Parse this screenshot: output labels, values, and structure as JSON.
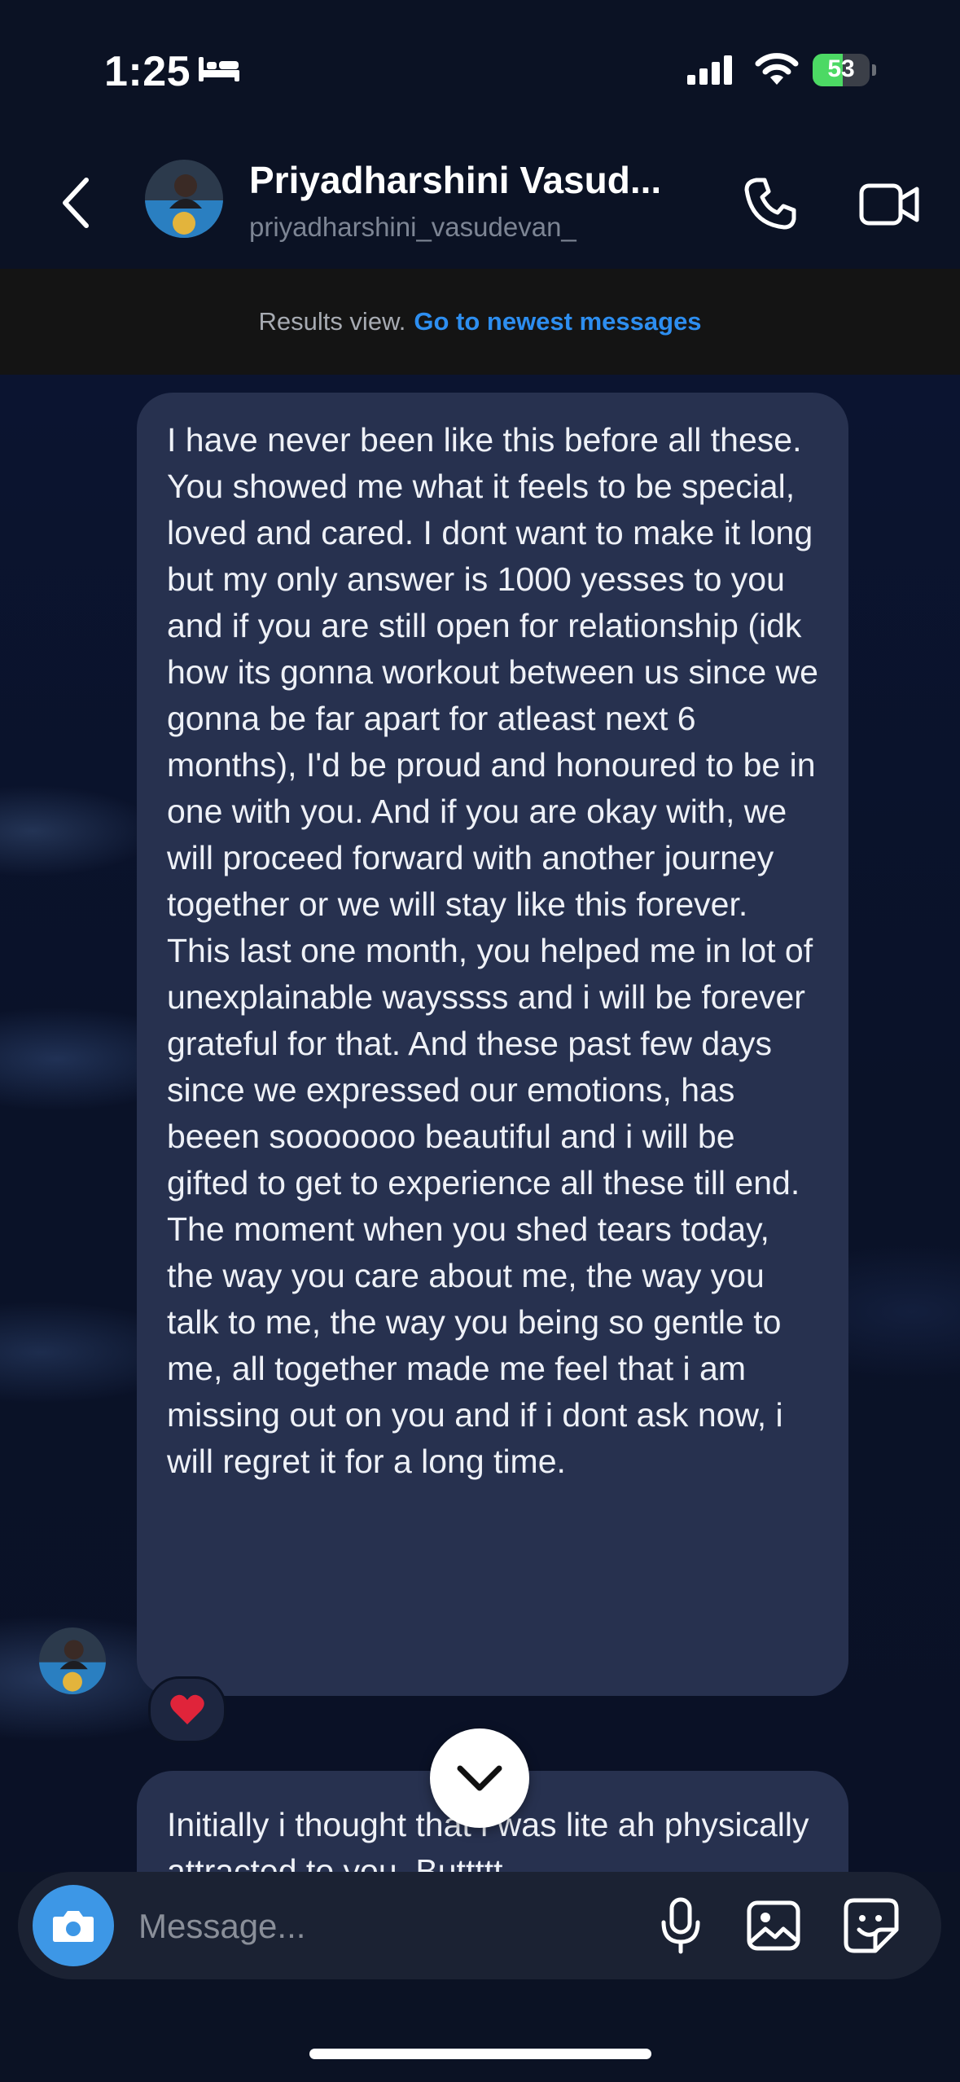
{
  "status_bar": {
    "time": "1:25",
    "battery_percent": "53",
    "battery_level": 0.53,
    "icons": [
      "bed-icon",
      "signal-icon",
      "wifi-icon",
      "battery-icon"
    ]
  },
  "header": {
    "contact_name": "Priyadharshini Vasud...",
    "username": "priyadharshini_vasudevan_",
    "icons": [
      "back-chevron-icon",
      "phone-icon",
      "video-camera-icon"
    ]
  },
  "banner": {
    "text": "Results view.",
    "link": "Go to newest messages"
  },
  "messages": [
    {
      "text": "I have never been like this before all these. You showed me what it feels to be special, loved and cared. I dont want to make it long but my only answer is 1000 yesses to you and if you are still open for relationship (idk how its gonna workout between us since we gonna be far apart for atleast next 6 months), I'd be proud and honoured to be in one with you. And if you are okay with, we will proceed forward with another journey together or we will stay like this forever. This last one month, you helped me in lot of unexplainable wayssss and i will be forever grateful for that. And these past few days since we expressed our emotions, has beeen sooooooo beautiful and i will be gifted to get to experience all these till end. The moment when you shed tears today, the way you care about me, the way you talk to me, the way you being so gentle to me, all together made me feel that i am missing out on you and if i dont ask now, i will regret it for a long time.",
      "reaction": "❤️"
    },
    {
      "text": "Initially i thought that i was lite ah physically attracted to you. Buttttt"
    }
  ],
  "composer": {
    "placeholder": "Message...",
    "value": "",
    "icons": [
      "camera-icon",
      "microphone-icon",
      "image-icon",
      "sticker-icon"
    ]
  },
  "colors": {
    "background": "#0b1224",
    "bubble": "#27314f",
    "link": "#2d8ef0",
    "camera_button": "#3d97e6",
    "battery_fill": "#4cd964"
  }
}
